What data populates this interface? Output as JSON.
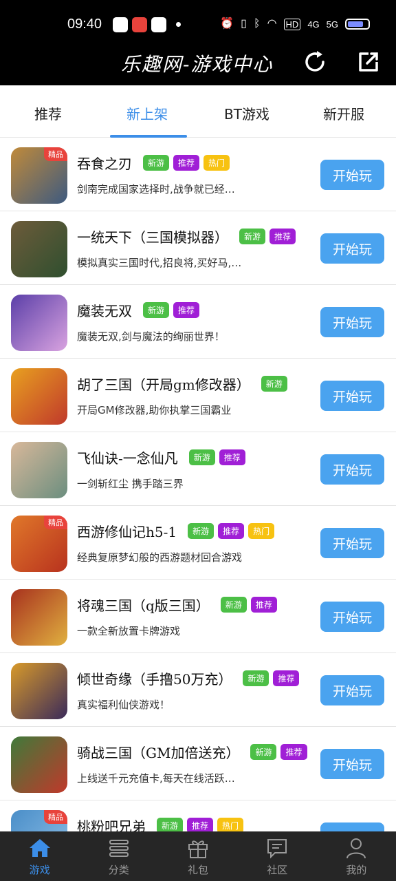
{
  "status": {
    "time": "09:40",
    "net1": "4G",
    "net2": "5G",
    "hd": "HD"
  },
  "header": {
    "title": "乐趣网-游戏中心"
  },
  "tabs": [
    {
      "label": "推荐",
      "active": false
    },
    {
      "label": "新上架",
      "active": true
    },
    {
      "label": "BT游戏",
      "active": false
    },
    {
      "label": "新开服",
      "active": false
    }
  ],
  "badge_label": "精品",
  "play_label": "开始玩",
  "tag_labels": {
    "new": "新游",
    "rec": "推荐",
    "hot": "热门"
  },
  "games": [
    {
      "name": "吞食之刃",
      "desc": "剑南完成国家选择时,战争就已经…",
      "tags": [
        "new",
        "rec",
        "hot"
      ],
      "badge": true,
      "colors": [
        "#c08a3a",
        "#3d5a80"
      ]
    },
    {
      "name": "一统天下（三国模拟器）",
      "desc": "模拟真实三国时代,招良将,买好马,…",
      "tags": [
        "new",
        "rec"
      ],
      "badge": false,
      "colors": [
        "#6d5b3a",
        "#2f4f2f"
      ]
    },
    {
      "name": "魔装无双",
      "desc": "魔装无双,剑与魔法的绚丽世界！",
      "tags": [
        "new",
        "rec"
      ],
      "badge": false,
      "colors": [
        "#5b3fa8",
        "#d9a3e0"
      ]
    },
    {
      "name": "胡了三国（开局gm修改器）",
      "desc": "开局GM修改器,助你执掌三国霸业",
      "tags": [
        "new"
      ],
      "badge": false,
      "colors": [
        "#e8a020",
        "#c0392b"
      ]
    },
    {
      "name": "飞仙诀-一念仙凡",
      "desc": "一剑斩红尘 携手踏三界",
      "tags": [
        "new",
        "rec"
      ],
      "badge": false,
      "colors": [
        "#d8b89a",
        "#6b8e7f"
      ]
    },
    {
      "name": "西游修仙记h5-1",
      "desc": "经典复原梦幻般的西游题材回合游戏",
      "tags": [
        "new",
        "rec",
        "hot"
      ],
      "badge": true,
      "colors": [
        "#e0782a",
        "#b8321e"
      ]
    },
    {
      "name": "将魂三国（q版三国）",
      "desc": "一款全新放置卡牌游戏",
      "tags": [
        "new",
        "rec"
      ],
      "badge": false,
      "colors": [
        "#a8321e",
        "#e0b040"
      ]
    },
    {
      "name": "倾世奇缘（手撸50万充）",
      "desc": "真实福利仙侠游戏！",
      "tags": [
        "new",
        "rec"
      ],
      "badge": false,
      "colors": [
        "#d89a2a",
        "#3a2a5a"
      ]
    },
    {
      "name": "骑战三国（GM加倍送充）",
      "desc": "上线送千元充值卡,每天在线活跃…",
      "tags": [
        "new",
        "rec"
      ],
      "badge": false,
      "colors": [
        "#3f7a3a",
        "#c0392b"
      ]
    },
    {
      "name": "桃粉吧兄弟",
      "desc": "",
      "tags": [
        "new",
        "rec",
        "hot"
      ],
      "badge": true,
      "colors": [
        "#4a8ec8",
        "#8fc0e8"
      ]
    }
  ],
  "nav": [
    {
      "label": "游戏",
      "icon": "home-icon",
      "active": true
    },
    {
      "label": "分类",
      "icon": "list-icon",
      "active": false
    },
    {
      "label": "礼包",
      "icon": "gift-icon",
      "active": false
    },
    {
      "label": "社区",
      "icon": "chat-icon",
      "active": false
    },
    {
      "label": "我的",
      "icon": "user-icon",
      "active": false
    }
  ]
}
